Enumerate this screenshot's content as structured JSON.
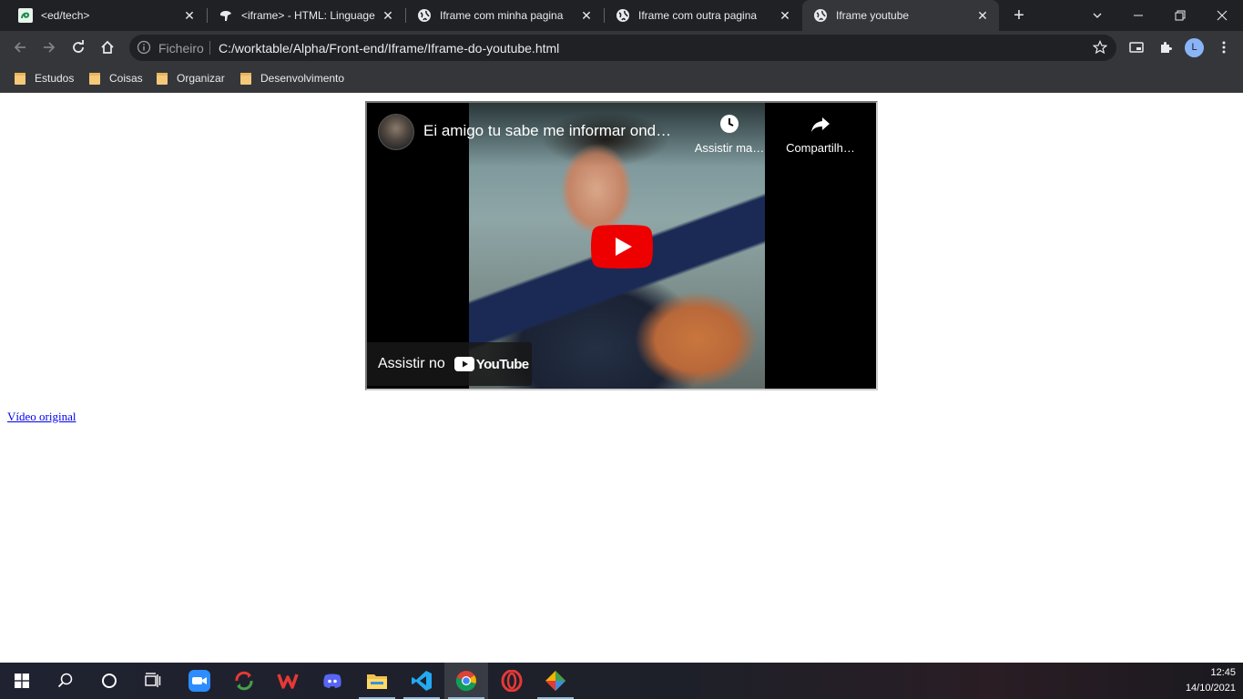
{
  "tabs": [
    {
      "title": "<ed/tech>",
      "favicon": "edtech-icon"
    },
    {
      "title": "<iframe> - HTML: Linguagem",
      "favicon": "mdn-icon"
    },
    {
      "title": "Iframe com minha pagina",
      "favicon": "globe-icon"
    },
    {
      "title": "Iframe com outra pagina",
      "favicon": "globe-icon"
    },
    {
      "title": "Iframe youtube",
      "favicon": "globe-icon",
      "active": true
    }
  ],
  "omnibox": {
    "scheme_label": "Ficheiro",
    "url": "C:/worktable/Alpha/Front-end/Iframe/Iframe-do-youtube.html"
  },
  "profile": {
    "initial": "L"
  },
  "bookmarks": [
    {
      "label": "Estudos"
    },
    {
      "label": "Coisas"
    },
    {
      "label": "Organizar"
    },
    {
      "label": "Desenvolvimento"
    }
  ],
  "video": {
    "title": "Ei amigo tu sabe me informar ond…",
    "watch_later": "Assistir ma…",
    "share": "Compartilh…",
    "watch_on": "Assistir no",
    "brand": "YouTube"
  },
  "page": {
    "link_text": "Vídeo original"
  },
  "taskbar": {
    "time": "12:45",
    "date": "14/10/2021"
  },
  "colors": {
    "tab_strip": "#202124",
    "toolbar": "#35363a",
    "youtube_red": "#ff0000",
    "link": "#0000ee"
  }
}
